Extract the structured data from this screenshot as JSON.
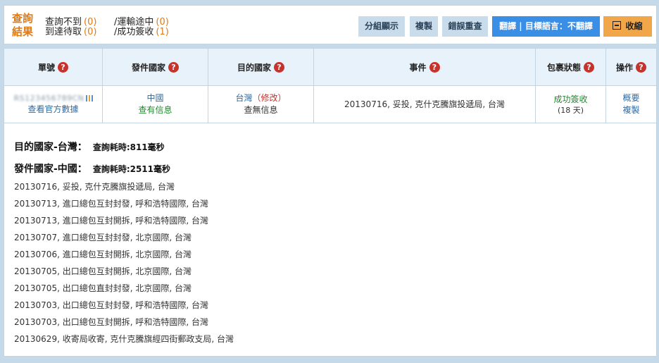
{
  "header": {
    "result_title": "查詢結果",
    "stats": [
      {
        "label": "查詢不到",
        "count": "(0)"
      },
      {
        "label": "/運輸途中",
        "count": "(0)"
      },
      {
        "label": "到達待取",
        "count": "(0)"
      },
      {
        "label": "/成功簽收",
        "count": "(1)"
      }
    ],
    "buttons": {
      "group_display": "分組顯示",
      "copy": "複製",
      "error_recheck": "錯誤重查",
      "translate": "翻譯 | 目標語言：不翻譯",
      "collapse": "收縮"
    }
  },
  "table": {
    "headers": {
      "tracking_no": "單號",
      "origin_country": "發件國家",
      "destination_country": "目的國家",
      "event": "事件",
      "status": "包裹狀態",
      "actions": "操作"
    },
    "row": {
      "tracking_no": "RS123456789CN",
      "official_data_link": "查看官方數據",
      "origin": "中國",
      "origin_info": "查有信息",
      "destination": "台灣",
      "destination_edit": "（修改）",
      "destination_info": "查無信息",
      "event": "20130716, 妥投, 克什克騰旗投遞局, 台灣",
      "status": "成功簽收",
      "status_days": "(18 天)",
      "action_overview": "概要",
      "action_copy": "複製"
    }
  },
  "details": {
    "destination": {
      "title": "目的國家-台灣：",
      "elapsed": "查詢耗時:811毫秒"
    },
    "origin": {
      "title": "發件國家-中國：",
      "elapsed": "查詢耗時:2511毫秒"
    },
    "events": [
      "20130716, 妥投, 克什克騰旗投遞局, 台灣",
      "20130713, 進口總包互封封發, 呼和浩特國際, 台灣",
      "20130713, 進口總包互封開拆, 呼和浩特國際, 台灣",
      "20130707, 進口總包互封封發, 北京國際, 台灣",
      "20130706, 進口總包互封開拆, 北京國際, 台灣",
      "20130705, 出口總包互封開拆, 北京國際, 台灣",
      "20130705, 出口總包直封封發, 北京國際, 台灣",
      "20130703, 出口總包互封封發, 呼和浩特國際, 台灣",
      "20130703, 出口總包互封開拆, 呼和浩特國際, 台灣",
      "20130629, 收寄局收寄, 克什克騰旗經四街郵政支局, 台灣"
    ]
  },
  "colors": {
    "accent_orange": "#e07a14",
    "button_blue": "#3a8ee6",
    "button_light": "#c9dcec",
    "button_orange": "#f2a64a",
    "help_red": "#c8322b",
    "status_green": "#1e8a2c",
    "link_blue": "#2d6aa0"
  }
}
